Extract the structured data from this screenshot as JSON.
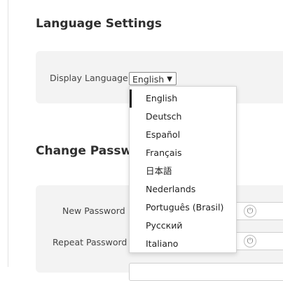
{
  "language_settings": {
    "title": "Language Settings",
    "display_language_label": "Display Language",
    "selected": "English",
    "caret": "▼",
    "options": [
      "English",
      "Deutsch",
      "Español",
      "Français",
      "日本語",
      "Nederlands",
      "Português (Brasil)",
      "Русский",
      "Italiano"
    ]
  },
  "change_password": {
    "title": "Change Password",
    "new_password_label": "New Password",
    "repeat_password_label": "Repeat Password"
  }
}
